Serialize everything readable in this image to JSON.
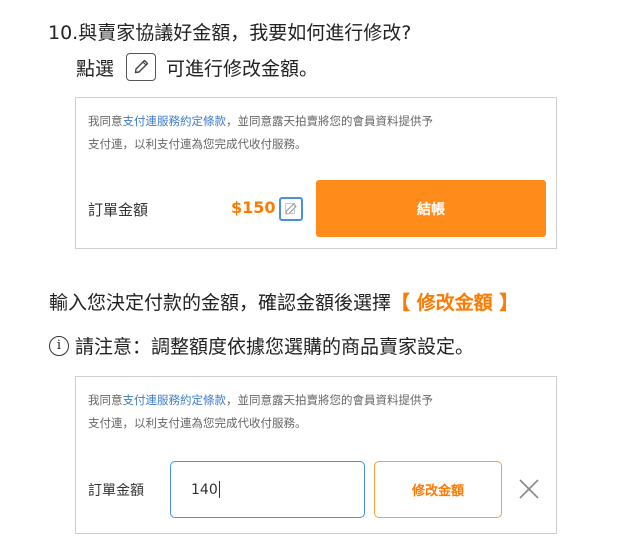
{
  "faq": {
    "question": "10.與賣家協議好金額，我要如何進行修改?",
    "instruction_prefix": "點選",
    "instruction_suffix": "可進行修改金額。"
  },
  "panel1": {
    "agree_prefix": "我同意",
    "agree_link": "支付連服務約定條款",
    "agree_rest_line1": "，並同意露天拍賣將您的會員資料提供予",
    "agree_line2": "支付連，以利支付連為您完成代收付服務。",
    "order_label": "訂單金額",
    "price": "$150",
    "checkout_label": "結帳"
  },
  "step2": {
    "text": "輸入您決定付款的金額，確認金額後選擇",
    "highlight": "【 修改金額 】"
  },
  "notice": {
    "icon_char": "i",
    "text": "請注意：調整額度依據您選購的商品賣家設定。"
  },
  "panel2": {
    "agree_prefix": "我同意",
    "agree_link": "支付連服務約定條款",
    "agree_rest_line1": "，並同意露天拍賣將您的會員資料提供予",
    "agree_line2": "支付連，以利支付連為您完成代收付服務。",
    "order_label": "訂單金額",
    "amount_value": "140",
    "modify_label": "修改金額"
  },
  "colors": {
    "accent": "#ff8c1a",
    "link": "#3d7cc9",
    "focus": "#4a90e2"
  },
  "icons": [
    "edit-icon",
    "info-icon",
    "close-icon"
  ]
}
